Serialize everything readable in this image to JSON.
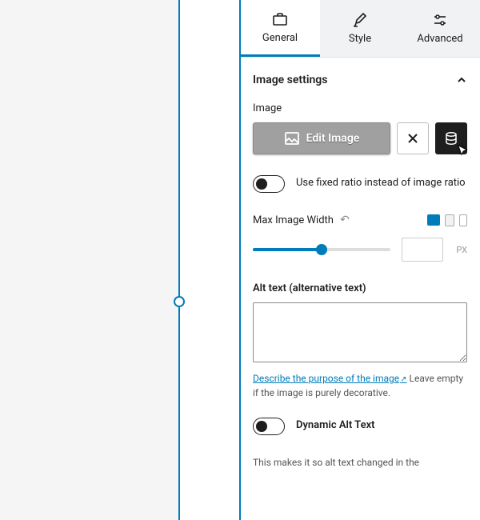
{
  "tabs": {
    "general": "General",
    "style": "Style",
    "advanced": "Advanced"
  },
  "section": {
    "title": "Image settings"
  },
  "image": {
    "label": "Image",
    "edit_btn": "Edit Image"
  },
  "fixed_ratio": {
    "label": "Use fixed ratio instead of image ratio"
  },
  "max_width": {
    "label": "Max Image Width",
    "unit": "PX",
    "value": ""
  },
  "alt": {
    "label": "Alt text (alternative text)",
    "value": "",
    "link_text": "Describe the purpose of the image",
    "helper_tail": "Leave empty if the image is purely decorative."
  },
  "dynamic_alt": {
    "label": "Dynamic Alt Text",
    "helper": "This makes it so alt text changed in the"
  }
}
